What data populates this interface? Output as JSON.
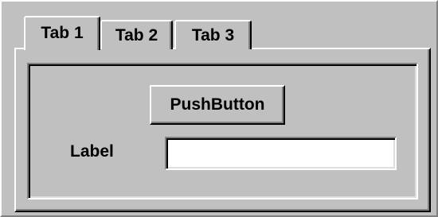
{
  "tabs": [
    {
      "label": "Tab 1",
      "selected": true
    },
    {
      "label": "Tab 2",
      "selected": false
    },
    {
      "label": "Tab 3",
      "selected": false
    }
  ],
  "button": {
    "label": "PushButton"
  },
  "form": {
    "label": "Label",
    "input_value": "",
    "input_placeholder": ""
  },
  "colors": {
    "face": "#c0c0c0",
    "highlight": "#ffffff",
    "shadow": "#808080",
    "dark_shadow": "#000000",
    "input_background": "#ffffff"
  }
}
